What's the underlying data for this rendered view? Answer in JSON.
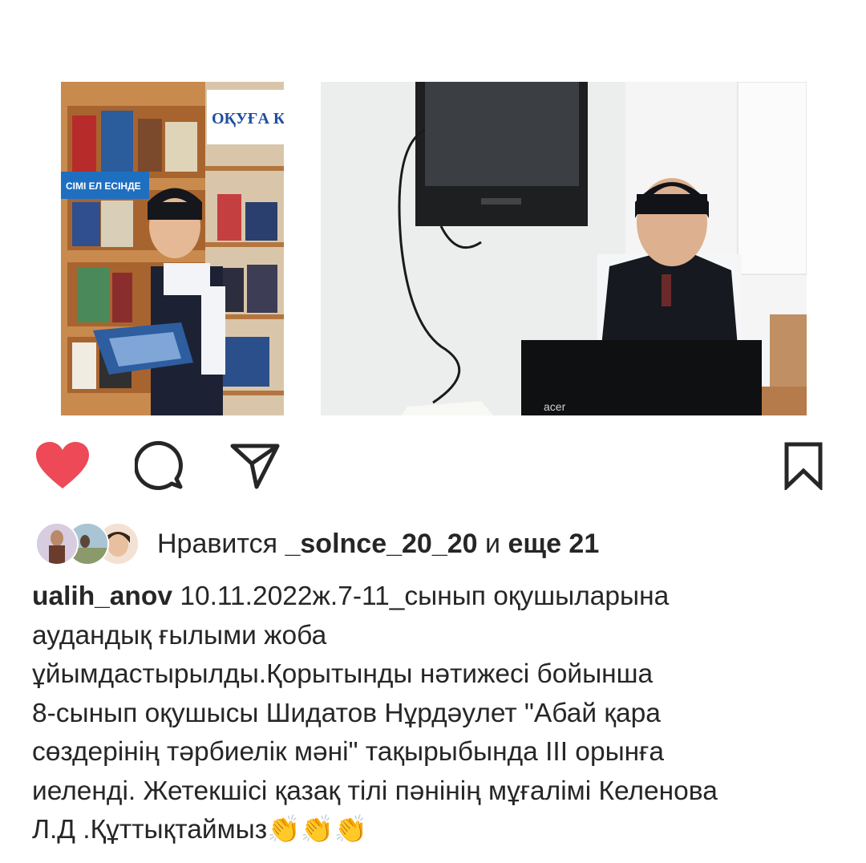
{
  "post": {
    "username": "ualih_anov",
    "liked": true,
    "likes": {
      "prefix": "Нравится",
      "user": "_solnce_20_20",
      "middle": "и",
      "others": "еще 21"
    },
    "caption_lines": [
      "10.11.2022ж.7-11_сынып оқушыларына",
      "аудандық ғылыми жоба",
      "ұйымдастырылды.Қорытынды нәтижесі бойынша",
      "8-сынып оқушысы Шидатов Нұрдәулет \"Абай қара",
      "сөздерінің тәрбиелік мәні\" тақырыбында ІІІ орынға",
      "иеленді. Жетекшісі қазақ тілі пәнінің мұғалімі Келенова",
      "Л.Д .Құттықтаймыз👏👏👏"
    ]
  },
  "photos": {
    "left": {
      "banner_text": "ОҚУҒА К",
      "sign_text": "СІМІ ЕЛ ЕСІНДЕ"
    },
    "right": {
      "laptop_brand": "acer"
    }
  },
  "colors": {
    "like_red": "#ed4956",
    "text": "#262626",
    "icon": "#262626"
  },
  "icons": {
    "like": "heart-icon",
    "comment": "comment-bubble-icon",
    "share": "paper-plane-icon",
    "save": "bookmark-icon"
  }
}
